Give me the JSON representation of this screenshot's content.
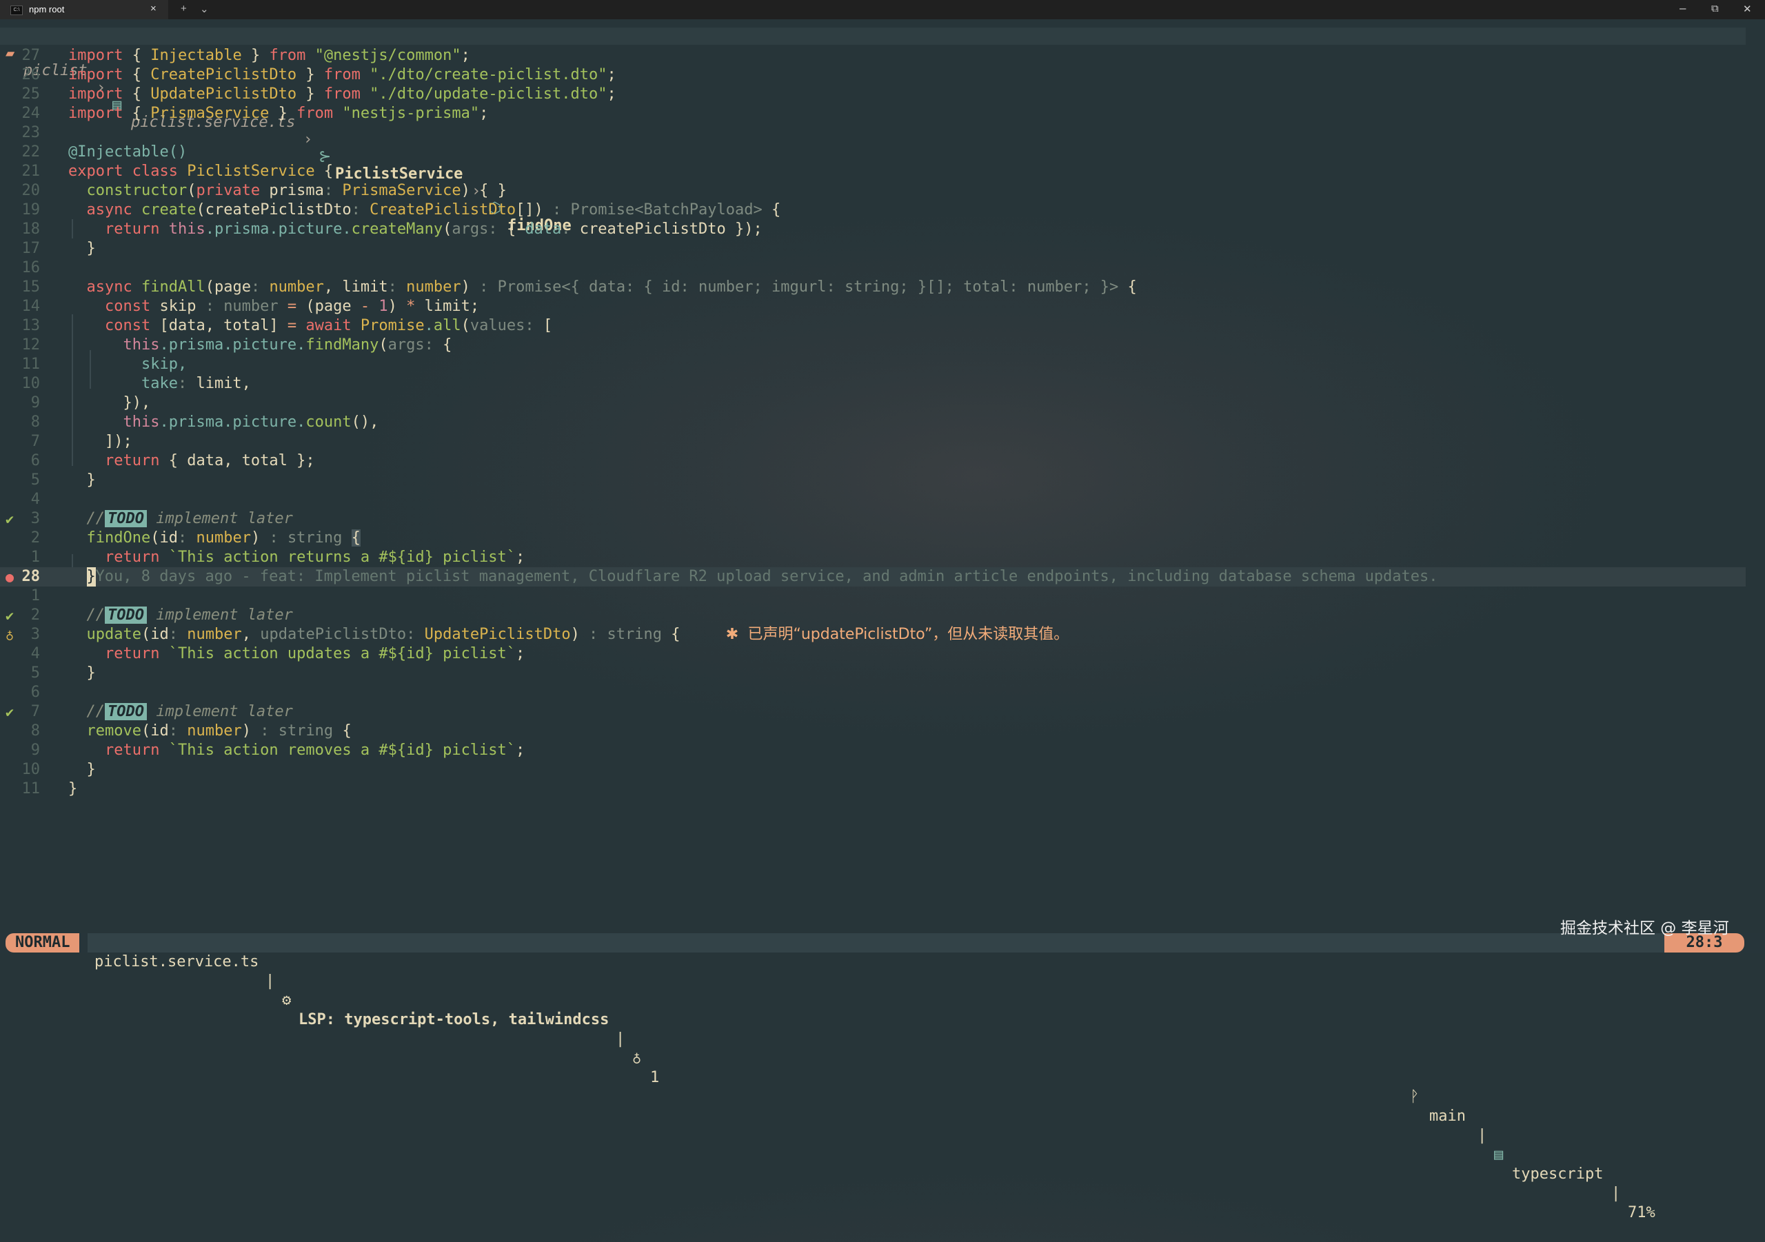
{
  "colors": {
    "mode": "#e69875",
    "keyword": "#eb6f6a",
    "function": "#a4c25c",
    "type": "#dbb44e",
    "todo_bg": "#7fb4a8",
    "diagnostic": "#f2ac7a"
  },
  "tab": {
    "label": "npm root",
    "close": "×",
    "new": "+",
    "dropdown": "⌄"
  },
  "window_controls": {
    "minimize": "–",
    "maximize": "⧉",
    "close": "✕"
  },
  "winbar": {
    "dir": "piclist",
    "file": "piclist.service.ts",
    "class": "PiclistService",
    "method": "findOne",
    "sep": "›"
  },
  "code": {
    "l27": [
      "27",
      "import",
      "{",
      "Injectable",
      "}",
      "from",
      "\"@nestjs/common\"",
      ";"
    ],
    "l26": [
      "26",
      "import",
      "{",
      "CreatePiclistDto",
      "}",
      "from",
      "\"./dto/create-piclist.dto\"",
      ";"
    ],
    "l25": [
      "25",
      "import",
      "{",
      "UpdatePiclistDto",
      "}",
      "from",
      "\"./dto/update-piclist.dto\"",
      ";"
    ],
    "l24": [
      "24",
      "import",
      "{",
      "PrismaService",
      "}",
      "from",
      "\"nestjs-prisma\"",
      ";"
    ],
    "l23": [
      "23"
    ],
    "l22": [
      "22",
      "@Injectable()"
    ],
    "l21": [
      "21",
      "export",
      "class",
      "PiclistService",
      "{"
    ],
    "l20": [
      "20",
      "constructor",
      "(",
      "private",
      "prisma",
      ":",
      "PrismaService",
      ")",
      "{ }"
    ],
    "l19": [
      "19",
      "async",
      "create",
      "(",
      "createPiclistDto",
      ":",
      "CreatePiclistDto",
      "[])",
      " : Promise<BatchPayload>",
      "{"
    ],
    "l18": [
      "18",
      "return",
      "this",
      ".prisma.picture.",
      "createMany",
      "(",
      "args:",
      "{",
      "data",
      ":",
      "createPiclistDto",
      "});"
    ],
    "l17": [
      "17",
      "}"
    ],
    "l16": [
      "16"
    ],
    "l15": [
      "15",
      "async",
      "findAll",
      "(",
      "page",
      ":",
      "number",
      ",",
      "limit",
      ":",
      "number",
      ")",
      " : Promise<{ data: { id: number; imgurl: string; }[]; total: number; }>",
      "{"
    ],
    "l14": [
      "14",
      "const",
      "skip",
      " : number",
      "=",
      "(page",
      "-",
      "1",
      ")",
      "*",
      "limit;"
    ],
    "l13": [
      "13",
      "const",
      "[data, total]",
      "=",
      "await",
      "Promise",
      ".",
      "all",
      "(",
      "values:",
      "["
    ],
    "l12": [
      "12",
      "this",
      ".prisma.picture.",
      "findMany",
      "(",
      "args:",
      "{"
    ],
    "l11": [
      "11",
      "skip,"
    ],
    "l10": [
      "10",
      "take",
      ":",
      "limit,"
    ],
    "l9": [
      "9",
      "}),"
    ],
    "l8": [
      "8",
      "this",
      ".prisma.picture.",
      "count",
      "(),"
    ],
    "l7": [
      "7",
      "]);"
    ],
    "l6": [
      "6",
      "return",
      "{ data, total };"
    ],
    "l5": [
      "5",
      "}"
    ],
    "l4": [
      "4"
    ],
    "l3": [
      "3",
      "//",
      "TODO",
      "implement later"
    ],
    "l2": [
      "2",
      "findOne",
      "(",
      "id",
      ":",
      "number",
      ")",
      " : string",
      "{"
    ],
    "l1": [
      "1",
      "return",
      "`This action returns a #${id} piclist`",
      ";"
    ],
    "l28cur": [
      "28",
      "You, 8 days ago - feat: Implement piclist management, Cloudflare R2 upload service, and admin article endpoints, including database schema updates."
    ],
    "a1": [
      "1"
    ],
    "a2": [
      "2",
      "//",
      "TODO",
      "implement later"
    ],
    "a3": [
      "3",
      "update",
      "(",
      "id",
      ":",
      "number",
      ",",
      "updatePiclistDto",
      ":",
      "UpdatePiclistDto",
      ")",
      " : string",
      "{",
      "已声明“updatePiclistDto”，但从未读取其值。"
    ],
    "a4": [
      "4",
      "return",
      "`This action updates a #${id} piclist`",
      ";"
    ],
    "a5": [
      "5",
      "}"
    ],
    "a6": [
      "6"
    ],
    "a7": [
      "7",
      "//",
      "TODO",
      "implement later"
    ],
    "a8": [
      "8",
      "remove",
      "(",
      "id",
      ":",
      "number",
      ")",
      " : string",
      "{"
    ],
    "a9": [
      "9",
      "return",
      "`This action removes a #${id} piclist`",
      ";"
    ],
    "a10": [
      "10",
      "}"
    ],
    "a11": [
      "11",
      "}"
    ]
  },
  "statusline": {
    "mode": "NORMAL",
    "file": "piclist.service.ts",
    "lsp": "LSP: typescript-tools, tailwindcss",
    "hints": "1",
    "branch": "main",
    "filetype": "typescript",
    "percent": "71%",
    "position": "28:3"
  },
  "watermark": "掘金技术社区 @ 李星河"
}
